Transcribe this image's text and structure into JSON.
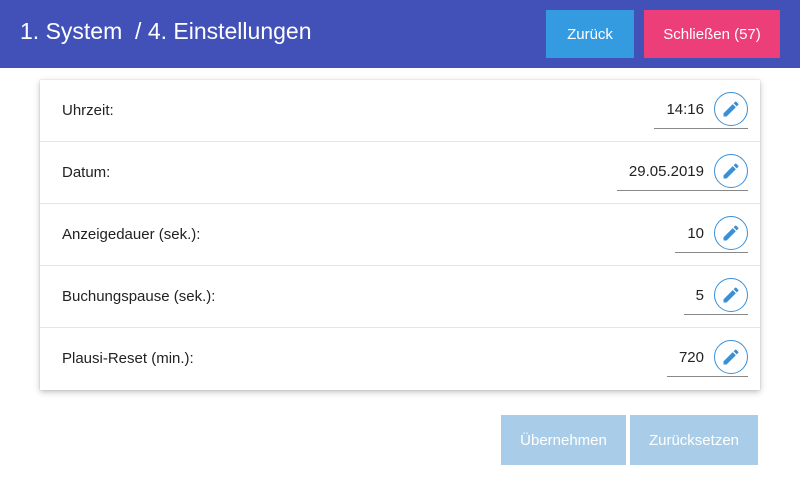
{
  "header": {
    "title": "1. System  / 4. Einstellungen",
    "back_label": "Zurück",
    "close_label": "Schließen (57)"
  },
  "settings": [
    {
      "label": "Uhrzeit:",
      "value": "14:16"
    },
    {
      "label": "Datum:",
      "value": "29.05.2019"
    },
    {
      "label": "Anzeigedauer (sek.):",
      "value": "10"
    },
    {
      "label": "Buchungspause (sek.):",
      "value": "5"
    },
    {
      "label": "Plausi-Reset (min.):",
      "value": "720"
    }
  ],
  "footer": {
    "apply_label": "Übernehmen",
    "reset_label": "Zurücksetzen"
  },
  "icons": {
    "edit": "pencil-icon"
  },
  "colors": {
    "header_bg": "#4251b8",
    "back_button": "#349be0",
    "close_button": "#ec3f7a",
    "disabled_button": "#a9cde8",
    "edit_icon": "#3b8fd4"
  }
}
